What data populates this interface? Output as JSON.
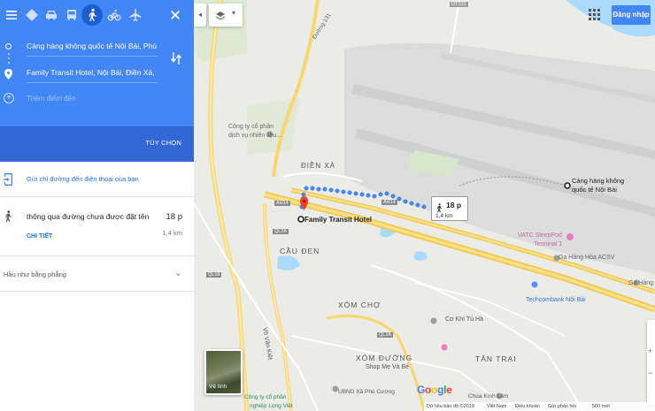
{
  "header": {
    "menu_icon": "hamburger-icon",
    "close_icon": "close-icon",
    "modes": [
      "directions-icon",
      "car-icon",
      "transit-icon",
      "walk-icon",
      "bicycle-icon",
      "flight-icon"
    ],
    "active_mode": "walk"
  },
  "route": {
    "origin": "Cảng hàng không quốc tế Nội Bài, Phù",
    "destination": "Family Transit Hotel, Nội Bài, Điền Xá,",
    "add_destination": "Thêm điểm đến",
    "options_label": "TÙY CHỌN"
  },
  "panel": {
    "send_to_phone": "Gửi chỉ đường đến điện thoại của bạn",
    "route_via": "thông qua đường chưa được đặt tên",
    "route_time": "18 p",
    "route_distance": "1,4 km",
    "details_label": "CHI TIẾT",
    "terrain_note": "Hầu như bằng phẳng"
  },
  "map": {
    "sign_in": "Đăng nhập",
    "callout_time": "18 p",
    "callout_distance": "1,4 km",
    "labels": {
      "duong131": "Đường 131",
      "dt131": "DT131",
      "cong_ty": "Công ty cổ phần",
      "dich_vu": "dịch vụ nhiên liệu...",
      "dien_xa": "ĐIỀN XÁ",
      "airport_line1": "Cảng hàng không",
      "airport_line2": "quốc tế Nội Bài",
      "hotel": "Family Transit Hotel",
      "ah14_a": "AH14",
      "ah14_b": "AH14",
      "ql2a_a": "QL2A",
      "ql2a_b": "QL2A",
      "ql18": "QL18",
      "cau_den": "CẦU ĐEN",
      "vatc": "VATC SleepPod",
      "terminal": "Terminal 1",
      "ga_hang_hoa": "Ga Hàng Hóa ACSV",
      "ga_hang": "Ga Hàng",
      "techcombank": "Techcombank Nội Bài",
      "xom_cho": "XÓM CHỢ",
      "co_khi": "Cơ Khí Tú Hà",
      "vo_van_kiet": "Võ Văn Kiệt",
      "xom_duong": "XÓM ĐƯỜNG",
      "tan_trai": "TÂN TRẠI",
      "shop_me": "Shop Mẹ Và Bé",
      "ubnd": "UBND Xã Phú Cường",
      "chua": "Chùa Kính Lâm",
      "cong_ty_bottom": "Công ty cổ phần",
      "nghiep": "nghiệp Long Việt"
    },
    "satellite_label": "Vệ tinh",
    "zoom_in": "+",
    "zoom_out": "−"
  },
  "footer": {
    "google": [
      "G",
      "o",
      "o",
      "g",
      "l",
      "e"
    ],
    "copyright": "Dữ liệu bản đồ ©2019",
    "country": "Việt Nam",
    "terms": "Điều khoản",
    "feedback": "Gửi phản hồi",
    "scale": "500 mét"
  }
}
